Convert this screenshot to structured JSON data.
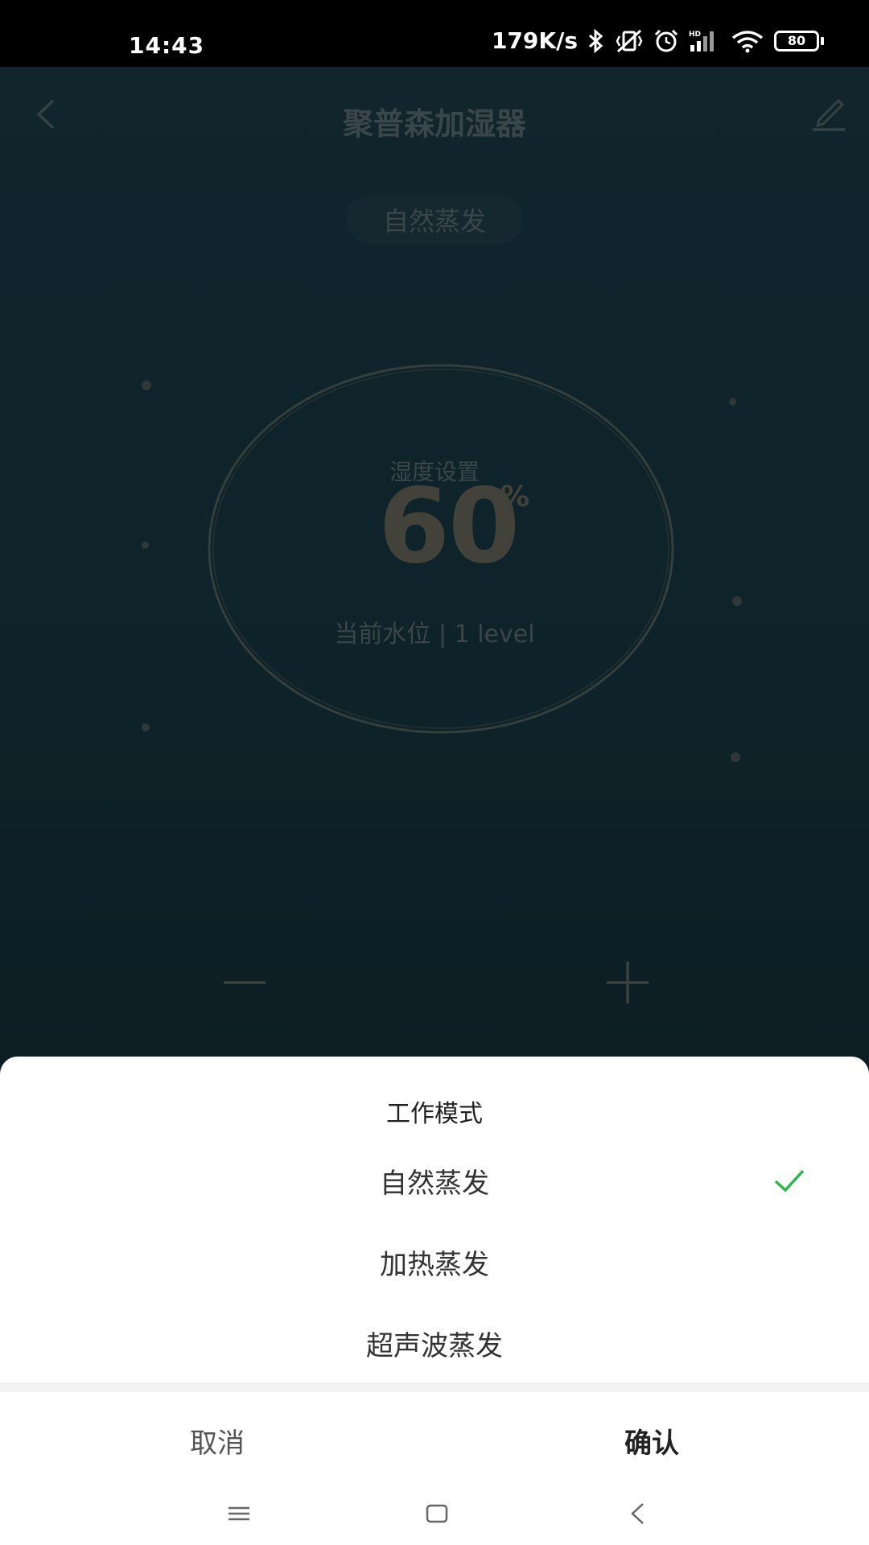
{
  "status_bar": {
    "time": "14:43",
    "network_speed": "179K/s",
    "battery_level": "80",
    "icons": [
      "bluetooth-icon",
      "vibrate-icon",
      "alarm-icon",
      "hd-signal-icon",
      "wifi-icon",
      "battery-icon"
    ]
  },
  "header": {
    "title": "聚普森加湿器",
    "mode": "自然蒸发"
  },
  "dial": {
    "label": "湿度设置",
    "value": "60",
    "unit": "%",
    "water_level": "当前水位 | 1 level"
  },
  "sheet": {
    "title": "工作模式",
    "options": [
      {
        "label": "自然蒸发",
        "selected": true
      },
      {
        "label": "加热蒸发",
        "selected": false
      },
      {
        "label": "超声波蒸发",
        "selected": false
      }
    ],
    "cancel_label": "取消",
    "confirm_label": "确认"
  },
  "colors": {
    "check": "#2db84c",
    "sheet_bg": "#ffffff",
    "app_bg": "#173843"
  }
}
